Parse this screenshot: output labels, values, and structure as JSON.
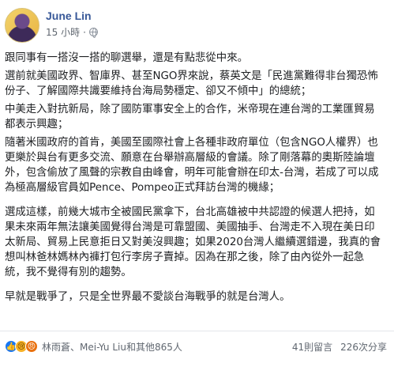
{
  "post": {
    "author": "June Lin",
    "time": "15 小時",
    "separator": "·",
    "paragraphs": [
      "跟同事有一搭沒一搭的聊選舉，還是有點悲從中來。",
      "選前就美國政界、智庫界、甚至NGO界來說，蔡英文是「民進黨難得非台獨恐怖份子、了解國際共識要維持台海局勢穩定、卻又不傾中」的總統；",
      "中美走入對抗新局，除了國防軍事安全上的合作，米帝現在連台灣的工業匯貿易都表示興趣；",
      "隨著米國政府的首肯，美國至國際社會上各種非政府單位（包含NGO人權界）也更樂於與台有更多交流、願意在台舉辦高層級的會議。除了剛落幕的奧斯陸論壇外，包含偷放了風聲的宗教自由峰會，明年可能會辦在印太-台灣，若成了可以成為極高層級官員如Pence、Pompeo正式拜訪台灣的機緣；",
      "選成這樣，前幾大城市全被國民黨拿下，台北高雄被中共認證的候選人把持，如果未來兩年無法讓美國覺得台灣是可靠盟國、美國抽手、台灣走不入現在美日印太新局、貿易上民意拒日又對美沒興趣；如果2020台灣人繼續選錯邊，我真的會想叫林爸林媽林內褲打包行李房子賣掉。因為在那之後，除了由內從外一起急統，我不覺得有別的趨勢。",
      "早就是戰爭了，只是全世界最不愛談台海戰爭的就是台灣人。"
    ]
  },
  "footer": {
    "reactions": [
      "like-icon",
      "sad-icon",
      "angry-icon"
    ],
    "reacted_by": "林雨蒼、Mei-Yu Liu和其他865人",
    "comments": "41則留言",
    "shares": "226次分享"
  },
  "colors": {
    "author": "#385898",
    "meta": "#606770",
    "text": "#1c1e21",
    "like": "#1877f2"
  }
}
